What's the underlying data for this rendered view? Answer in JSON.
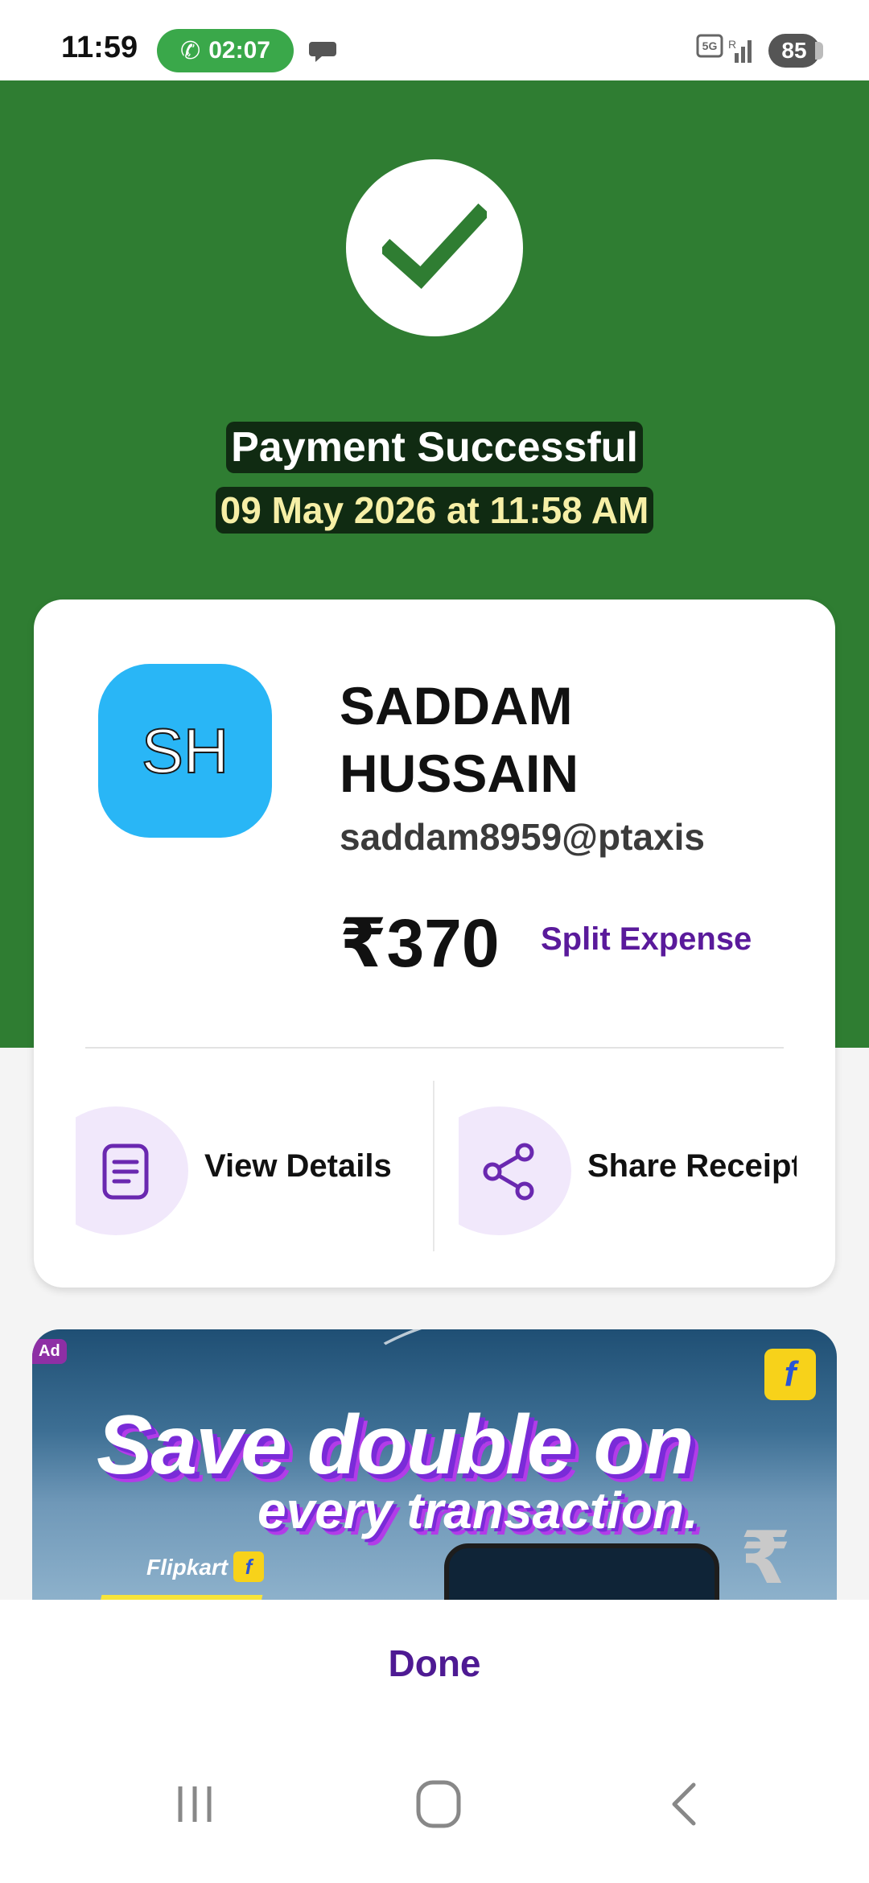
{
  "status_bar": {
    "time": "11:59",
    "call_timer": "02:07",
    "network": "5G",
    "battery": "85"
  },
  "header": {
    "title": "Payment Successful",
    "datetime": "09 May 2026 at 11:58 AM",
    "bg_color": "#2f7d32"
  },
  "payee": {
    "initials": "SH",
    "name": "SADDAM HUSSAIN",
    "upi_id": "saddam8959@ptaxis",
    "amount": "₹370",
    "split_label": "Split Expense"
  },
  "actions": [
    {
      "label": "View Details",
      "icon": "document-icon"
    },
    {
      "label": "Share Receipt",
      "icon": "share-icon"
    }
  ],
  "ad": {
    "tag": "Ad",
    "line1": "Save double on",
    "line2": "every transaction.",
    "store": "Flipkart",
    "badge": "f"
  },
  "footer": {
    "done_label": "Done"
  },
  "accent_color": "#5a1a9b"
}
